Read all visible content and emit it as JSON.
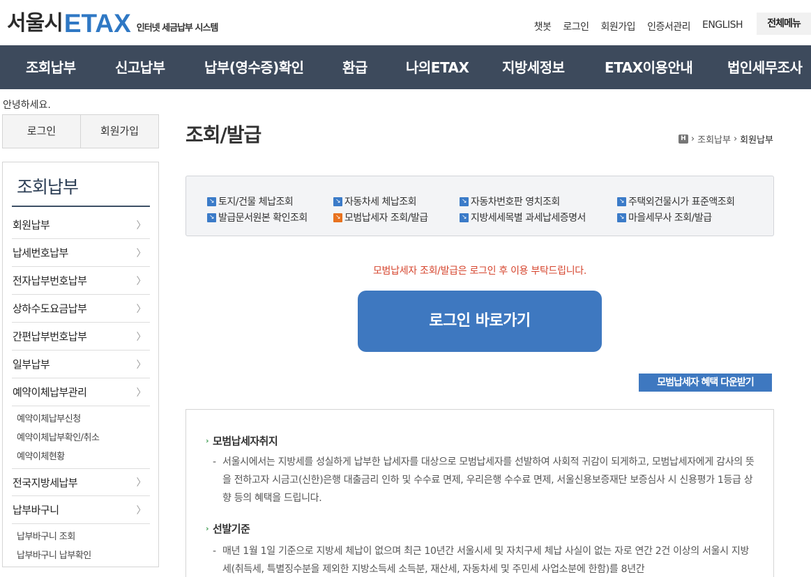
{
  "header": {
    "logo_ko": "서울시",
    "logo_en": "ETAX",
    "logo_sub": "인터넷 세금납부 시스템",
    "top_links": [
      "챗봇",
      "로그인",
      "회원가입",
      "인증서관리",
      "ENGLISH"
    ],
    "all_menu": "전체메뉴"
  },
  "gnb": [
    "조회납부",
    "신고납부",
    "납부(영수증)확인",
    "환급",
    "나의ETAX",
    "지방세정보",
    "ETAX이용안내",
    "법인세무조사"
  ],
  "sidebar": {
    "greeting": "안녕하세요.",
    "login": "로그인",
    "join": "회원가입",
    "title": "조회납부",
    "items": [
      {
        "label": "회원납부"
      },
      {
        "label": "납세번호납부"
      },
      {
        "label": "전자납부번호납부"
      },
      {
        "label": "상하수도요금납부"
      },
      {
        "label": "간편납부번호납부"
      },
      {
        "label": "일부납부"
      },
      {
        "label": "예약이체납부관리"
      },
      {
        "label": "전국지방세납부"
      },
      {
        "label": "납부바구니"
      }
    ],
    "sub_reserve": [
      "예약이체납부신청",
      "예약이체납부확인/취소",
      "예약이체현황"
    ],
    "sub_basket": [
      "납부바구니 조회",
      "납부바구니 납부확인"
    ]
  },
  "main": {
    "title": "조회/발급",
    "breadcrumb": {
      "home": "H",
      "items": [
        "조회납부",
        "회원납부"
      ]
    },
    "quick_links": [
      "토지/건물 체납조회",
      "자동차세 체납조회",
      "자동차번호판 영치조회",
      "주택외건물시가 표준액조회",
      "발급문서원본 확인조회",
      "모범납세자 조회/발급",
      "지방세세목별 과세납세증명서",
      "마을세무사 조회/발급"
    ],
    "notice": "모범납세자 조회/발급은 로그인 후 이용 부탁드립니다.",
    "login_button": "로그인 바로가기",
    "benefit_button": "모범납세자 혜택 다운받기",
    "sections": [
      {
        "title": "모범납세자취지",
        "body": "서울시에서는 지방세를 성실하게 납부한 납세자를 대상으로 모범납세자를 선발하여 사회적 귀감이 되게하고, 모범납세자에게 감사의 뜻을 전하고자 시금고(신한)은행 대출금리 인하 및 수수료 면제, 우리은행 수수료 면제, 서울신용보증재단 보증심사 시 신용평가 1등급 상향 등의 혜택을 드립니다."
      },
      {
        "title": "선발기준",
        "body": "매년 1월 1일 기준으로 지방세 체납이 없으며 최근 10년간 서울시세 및 자치구세 체납 사실이 없는 자로 연간 2건 이상의 서울시 지방세(취득세, 특별징수분을 제외한 지방소득세 소득분, 재산세, 자동차세 및 주민세 사업소분에 한함)를 8년간"
      }
    ]
  },
  "colors": {
    "gnb_bg": "#3d4a5c",
    "accent_blue": "#3e78c0",
    "notice_red": "#d6452e",
    "logo_blue": "#2f78c4"
  }
}
